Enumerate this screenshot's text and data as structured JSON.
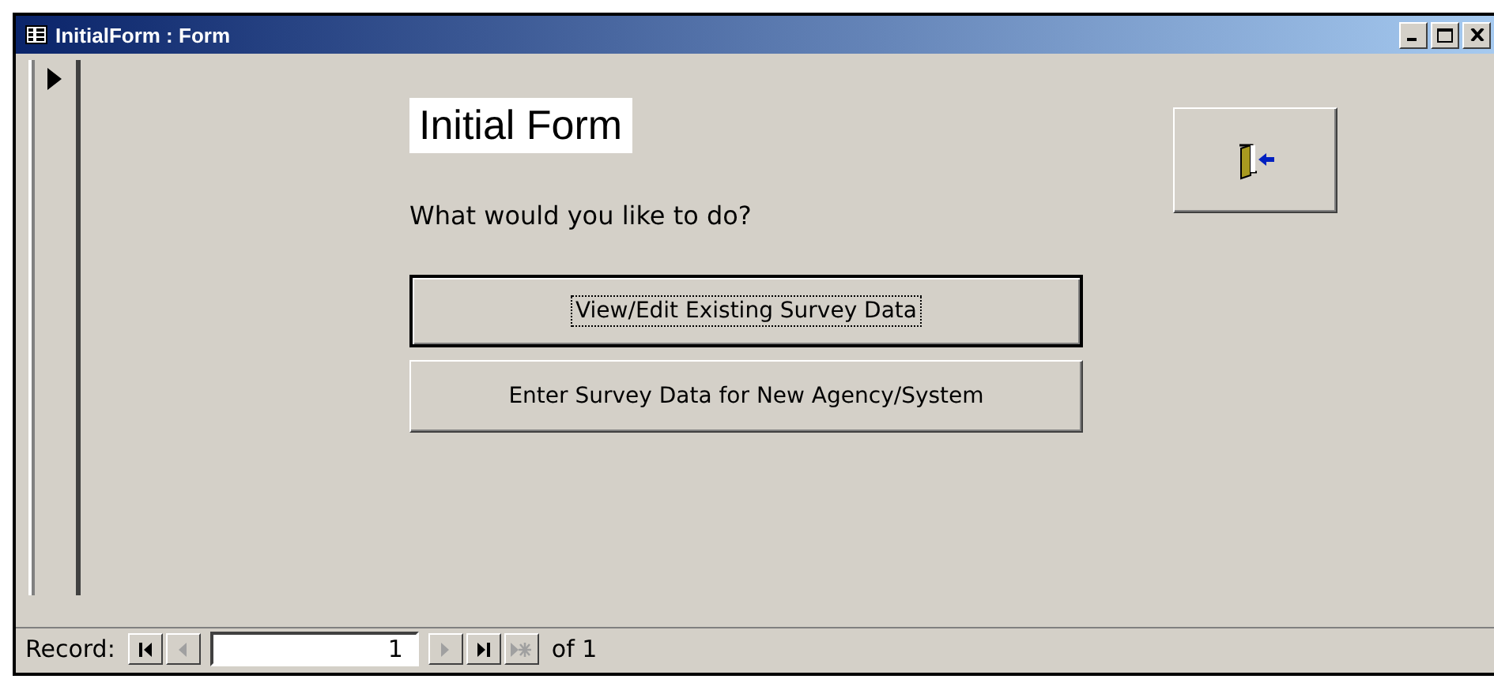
{
  "window": {
    "title": "InitialForm : Form"
  },
  "form": {
    "heading": "Initial Form",
    "prompt": "What would you like to do?",
    "buttons": [
      {
        "label": "View/Edit Existing Survey Data",
        "focused": true
      },
      {
        "label": "Enter Survey Data for New Agency/System",
        "focused": false
      }
    ]
  },
  "navigation": {
    "label": "Record:",
    "record": "1",
    "total": "of 1",
    "buttons": [
      {
        "kind": "first",
        "disabled": false
      },
      {
        "kind": "prev",
        "disabled": true
      }
    ],
    "after_buttons": [
      {
        "kind": "next",
        "disabled": true
      },
      {
        "kind": "last",
        "disabled": false
      },
      {
        "kind": "new",
        "disabled": true
      }
    ]
  }
}
